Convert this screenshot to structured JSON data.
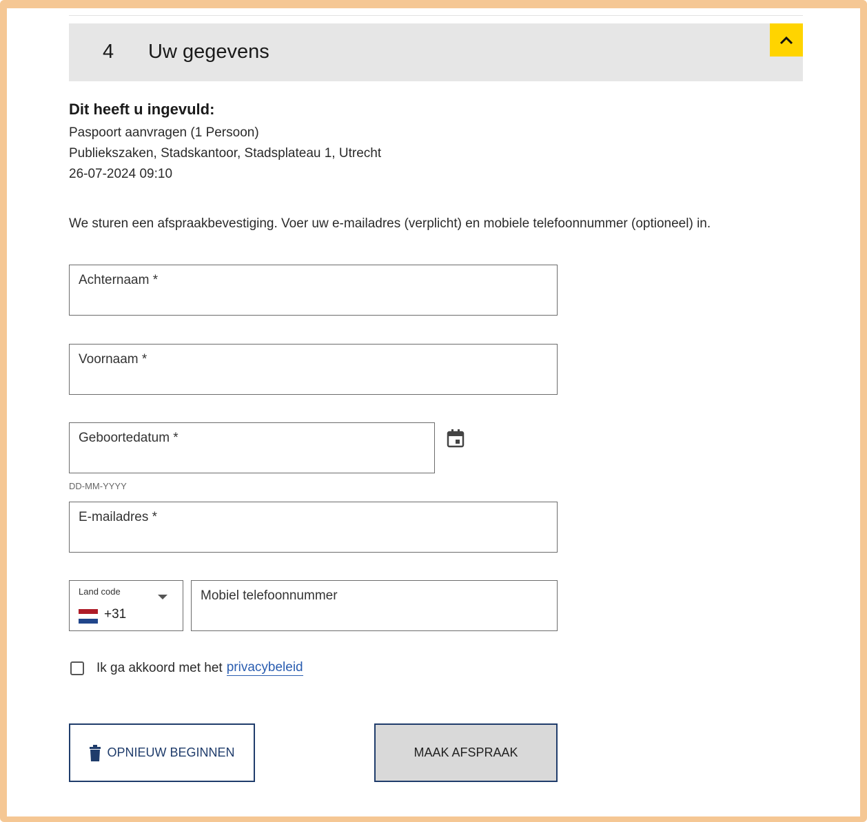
{
  "header": {
    "step_number": "4",
    "title": "Uw gegevens"
  },
  "colors": {
    "frame": "#f5c794",
    "collapse_button": "#ffd400",
    "header_bg": "#e6e6e6",
    "button_border": "#1f3c6b",
    "link": "#2a5db0"
  },
  "icons": {
    "collapse": "chevron-up-icon",
    "calendar": "calendar-icon",
    "trash": "trash-icon",
    "flag": "netherlands-flag-icon"
  },
  "summary": {
    "title": "Dit heeft u ingevuld:",
    "lines": [
      "Paspoort aanvragen (1 Persoon)",
      "Publiekszaken, Stadskantoor, Stadsplateau 1, Utrecht",
      "26-07-2024 09:10"
    ]
  },
  "intro": "We sturen een afspraakbevestiging. Voer uw e-mailadres (verplicht) en mobiele telefoonnummer (optioneel) in.",
  "form": {
    "last_name": {
      "label": "Achternaam *",
      "value": ""
    },
    "first_name": {
      "label": "Voornaam *",
      "value": ""
    },
    "birthdate": {
      "label": "Geboortedatum *",
      "value": "",
      "hint": "DD-MM-YYYY"
    },
    "email": {
      "label": "E-mailadres *",
      "value": ""
    },
    "country_code": {
      "label": "Land code",
      "value": "+31"
    },
    "phone": {
      "label": "Mobiel telefoonnummer",
      "value": ""
    }
  },
  "consent": {
    "text": "Ik ga akkoord met het",
    "link": "privacybeleid",
    "checked": false
  },
  "buttons": {
    "reset": "OPNIEUW BEGINNEN",
    "submit": "MAAK AFSPRAAK"
  }
}
